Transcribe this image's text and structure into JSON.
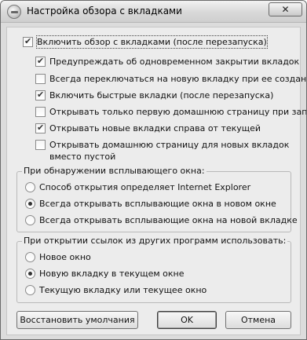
{
  "window": {
    "title": "Настройка обзора с вкладками",
    "close_label": "✕"
  },
  "main_checkbox": {
    "label": "Включить обзор с вкладками (после перезапуска)",
    "checked": true
  },
  "options": [
    {
      "label": "Предупреждать об одновременном закрытии вкладок",
      "checked": true
    },
    {
      "label": "Всегда переключаться на новую вкладку при ее создании",
      "checked": false
    },
    {
      "label": "Включить быстрые вкладки (после перезапуска)",
      "checked": true
    },
    {
      "label": "Открывать только первую домашнюю страницу при запуске",
      "checked": false
    },
    {
      "label": "Открывать новые вкладки справа от текущей",
      "checked": true
    },
    {
      "label_line1": "Открывать домашнюю страницу для новых вкладок",
      "label_line2": "вместо пустой",
      "checked": false
    }
  ],
  "popup_group": {
    "title": "При обнаружении всплывающего окна:",
    "options": [
      {
        "label": "Способ открытия определяет Internet Explorer",
        "checked": false
      },
      {
        "label": "Всегда открывать всплывающие окна в новом окне",
        "checked": true
      },
      {
        "label": "Всегда открывать всплывающие окна на новой вкладке",
        "checked": false
      }
    ]
  },
  "links_group": {
    "title": "При открытии ссылок из других программ использовать:",
    "options": [
      {
        "label": "Новое окно",
        "checked": false
      },
      {
        "label": "Новую вкладку в текущем окне",
        "checked": true
      },
      {
        "label": "Текущую вкладку или текущее окно",
        "checked": false
      }
    ]
  },
  "buttons": {
    "restore": "Восстановить умолчания",
    "ok": "OK",
    "cancel": "Отмена"
  }
}
